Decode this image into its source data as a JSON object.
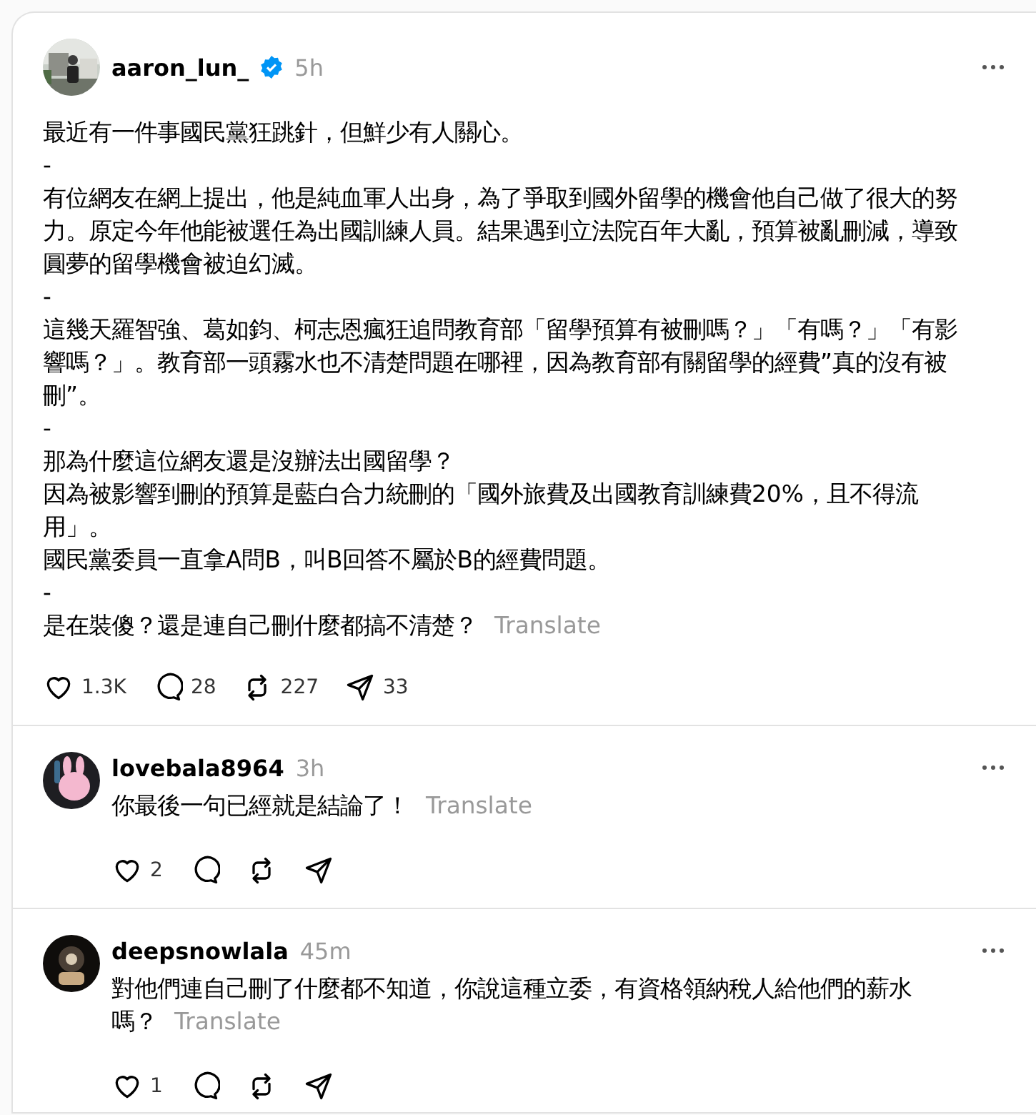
{
  "post": {
    "author": "aaron_lun_",
    "verified": true,
    "time": "5h",
    "paragraphs": [
      "最近有一件事國民黨狂跳針，但鮮少有人關心。",
      "-",
      "有位網友在網上提出，他是純血軍人出身，為了爭取到國外留學的機會他自己做了很大的努力。原定今年他能被選任為出國訓練人員。結果遇到立法院百年大亂，預算被亂刪減，導致圓夢的留學機會被迫幻滅。",
      "-",
      "這幾天羅智強、葛如鈞、柯志恩瘋狂追問教育部「留學預算有被刪嗎？」「有嗎？」「有影響嗎？」。教育部一頭霧水也不清楚問題在哪裡，因為教育部有關留學的經費”真的沒有被刪”。",
      "-",
      "那為什麼這位網友還是沒辦法出國留學？",
      "因為被影響到刪的預算是藍白合力統刪的「國外旅費及出國教育訓練費20%，且不得流用」。",
      "國民黨委員一直拿A問B，叫B回答不屬於B的經費問題。",
      "-",
      "是在裝傻？還是連自己刪什麼都搞不清楚？"
    ],
    "translate": "Translate",
    "actions": {
      "likes": "1.3K",
      "comments": "28",
      "reposts": "227",
      "shares": "33"
    }
  },
  "replies": [
    {
      "author": "lovebala8964",
      "time": "3h",
      "text": "你最後一句已經就是結論了！",
      "translate": "Translate",
      "actions": {
        "likes": "2"
      }
    },
    {
      "author": "deepsnowlala",
      "time": "45m",
      "text": "對他們連自己刪了什麼都不知道，你說這種立委，有資格領納稅人給他們的薪水嗎？",
      "translate": "Translate",
      "actions": {
        "likes": "1"
      }
    }
  ]
}
